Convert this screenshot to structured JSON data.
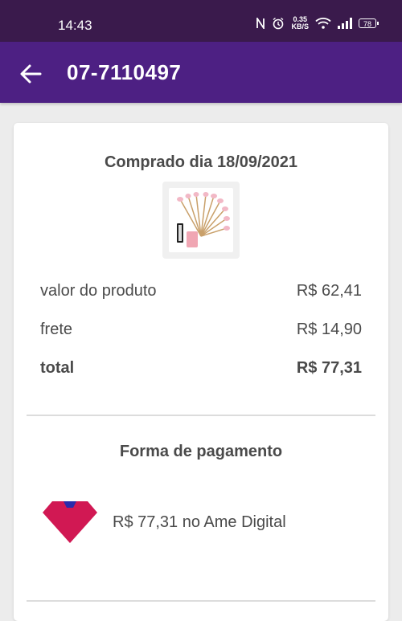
{
  "status_bar": {
    "time": "14:43",
    "net_speed_value": "0.35",
    "net_speed_unit": "KB/S",
    "battery": "78",
    "icons": [
      "nfc-icon",
      "alarm-icon",
      "wifi-icon",
      "signal-icon",
      "battery-icon"
    ]
  },
  "app_bar": {
    "title": "07-7110497",
    "background": "#4d2083",
    "back_icon": "arrow-left-icon"
  },
  "order": {
    "purchase_date": "Comprado dia 18/09/2021",
    "product_image": "kitchen-utensils-set-thumbnail",
    "rows": [
      {
        "label": "valor do produto",
        "value": "R$ 62,41"
      },
      {
        "label": "frete",
        "value": "R$ 14,90"
      },
      {
        "label": "total",
        "value": "R$ 77,31"
      }
    ]
  },
  "payment": {
    "section_title": "Forma de pagamento",
    "logo": "ame-digital-logo",
    "description": "R$ 77,31 no Ame Digital",
    "colors": {
      "logo_red": "#d11853",
      "logo_blue": "#2a2bab"
    }
  }
}
